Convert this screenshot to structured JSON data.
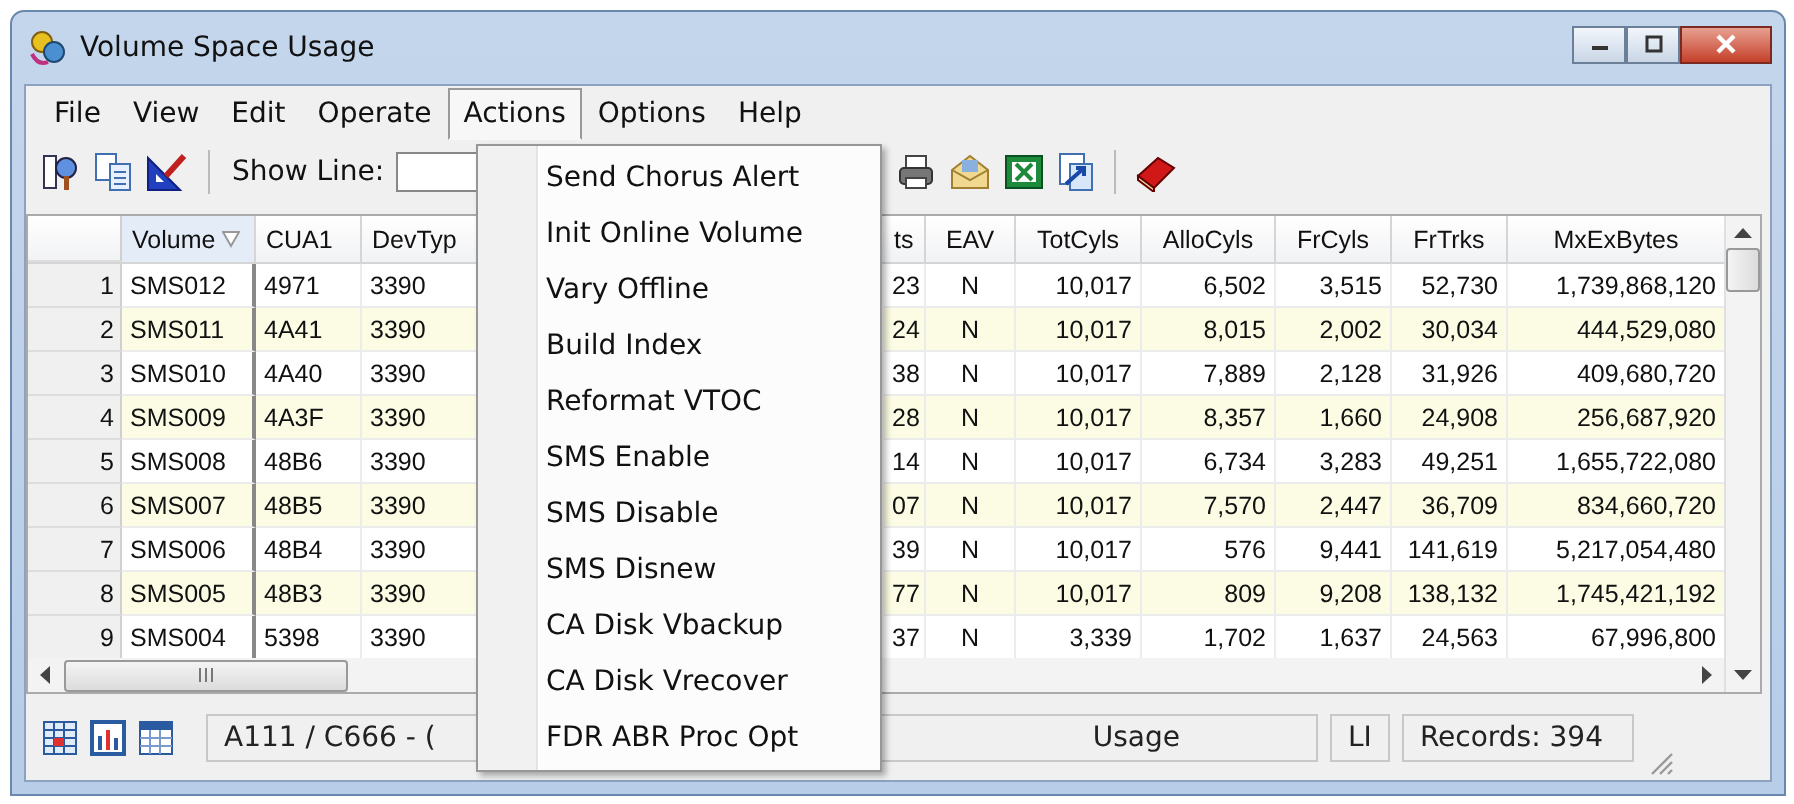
{
  "window": {
    "title": "Volume Space Usage"
  },
  "menu_bar": [
    {
      "label": "File",
      "selected": false
    },
    {
      "label": "View",
      "selected": false
    },
    {
      "label": "Edit",
      "selected": false
    },
    {
      "label": "Operate",
      "selected": false
    },
    {
      "label": "Actions",
      "selected": true
    },
    {
      "label": "Options",
      "selected": false
    },
    {
      "label": "Help",
      "selected": false
    }
  ],
  "actions_menu": [
    "Send Chorus Alert",
    "Init Online Volume",
    "Vary Offline",
    "Build Index",
    "Reformat VTOC",
    "SMS Enable",
    "SMS Disable",
    "SMS Disnew",
    "CA Disk Vbackup",
    "CA Disk Vrecover",
    "FDR ABR Proc Opt"
  ],
  "toolbar": {
    "show_line_label": "Show Line:"
  },
  "table": {
    "columns": [
      {
        "label": "Volume",
        "sorted": true
      },
      {
        "label": "CUA1",
        "sorted": false
      },
      {
        "label": "DevTyp",
        "sorted": false
      },
      {
        "label": "ts",
        "sorted": false
      },
      {
        "label": "EAV",
        "sorted": false
      },
      {
        "label": "TotCyls",
        "sorted": false
      },
      {
        "label": "AlloCyls",
        "sorted": false
      },
      {
        "label": "FrCyls",
        "sorted": false
      },
      {
        "label": "FrTrks",
        "sorted": false
      },
      {
        "label": "MxExBytes",
        "sorted": false
      }
    ],
    "rows": [
      {
        "number": "1",
        "cells": [
          "SMS012",
          "4971",
          "3390",
          "23",
          "N",
          "10,017",
          "6,502",
          "3,515",
          "52,730",
          "1,739,868,120"
        ]
      },
      {
        "number": "2",
        "cells": [
          "SMS011",
          "4A41",
          "3390",
          "24",
          "N",
          "10,017",
          "8,015",
          "2,002",
          "30,034",
          "444,529,080"
        ]
      },
      {
        "number": "3",
        "cells": [
          "SMS010",
          "4A40",
          "3390",
          "38",
          "N",
          "10,017",
          "7,889",
          "2,128",
          "31,926",
          "409,680,720"
        ]
      },
      {
        "number": "4",
        "cells": [
          "SMS009",
          "4A3F",
          "3390",
          "28",
          "N",
          "10,017",
          "8,357",
          "1,660",
          "24,908",
          "256,687,920"
        ]
      },
      {
        "number": "5",
        "cells": [
          "SMS008",
          "48B6",
          "3390",
          "14",
          "N",
          "10,017",
          "6,734",
          "3,283",
          "49,251",
          "1,655,722,080"
        ]
      },
      {
        "number": "6",
        "cells": [
          "SMS007",
          "48B5",
          "3390",
          "07",
          "N",
          "10,017",
          "7,570",
          "2,447",
          "36,709",
          "834,660,720"
        ]
      },
      {
        "number": "7",
        "cells": [
          "SMS006",
          "48B4",
          "3390",
          "39",
          "N",
          "10,017",
          "576",
          "9,441",
          "141,619",
          "5,217,054,480"
        ]
      },
      {
        "number": "8",
        "cells": [
          "SMS005",
          "48B3",
          "3390",
          "77",
          "N",
          "10,017",
          "809",
          "9,208",
          "138,132",
          "1,745,421,192"
        ]
      },
      {
        "number": "9",
        "cells": [
          "SMS004",
          "5398",
          "3390",
          "37",
          "N",
          "3,339",
          "1,702",
          "1,637",
          "24,563",
          "67,996,800"
        ]
      }
    ]
  },
  "status_bar": {
    "text_start": "A111 / C666 - (",
    "text_end": "Usage",
    "mode": "LI",
    "records": "Records: 394"
  }
}
